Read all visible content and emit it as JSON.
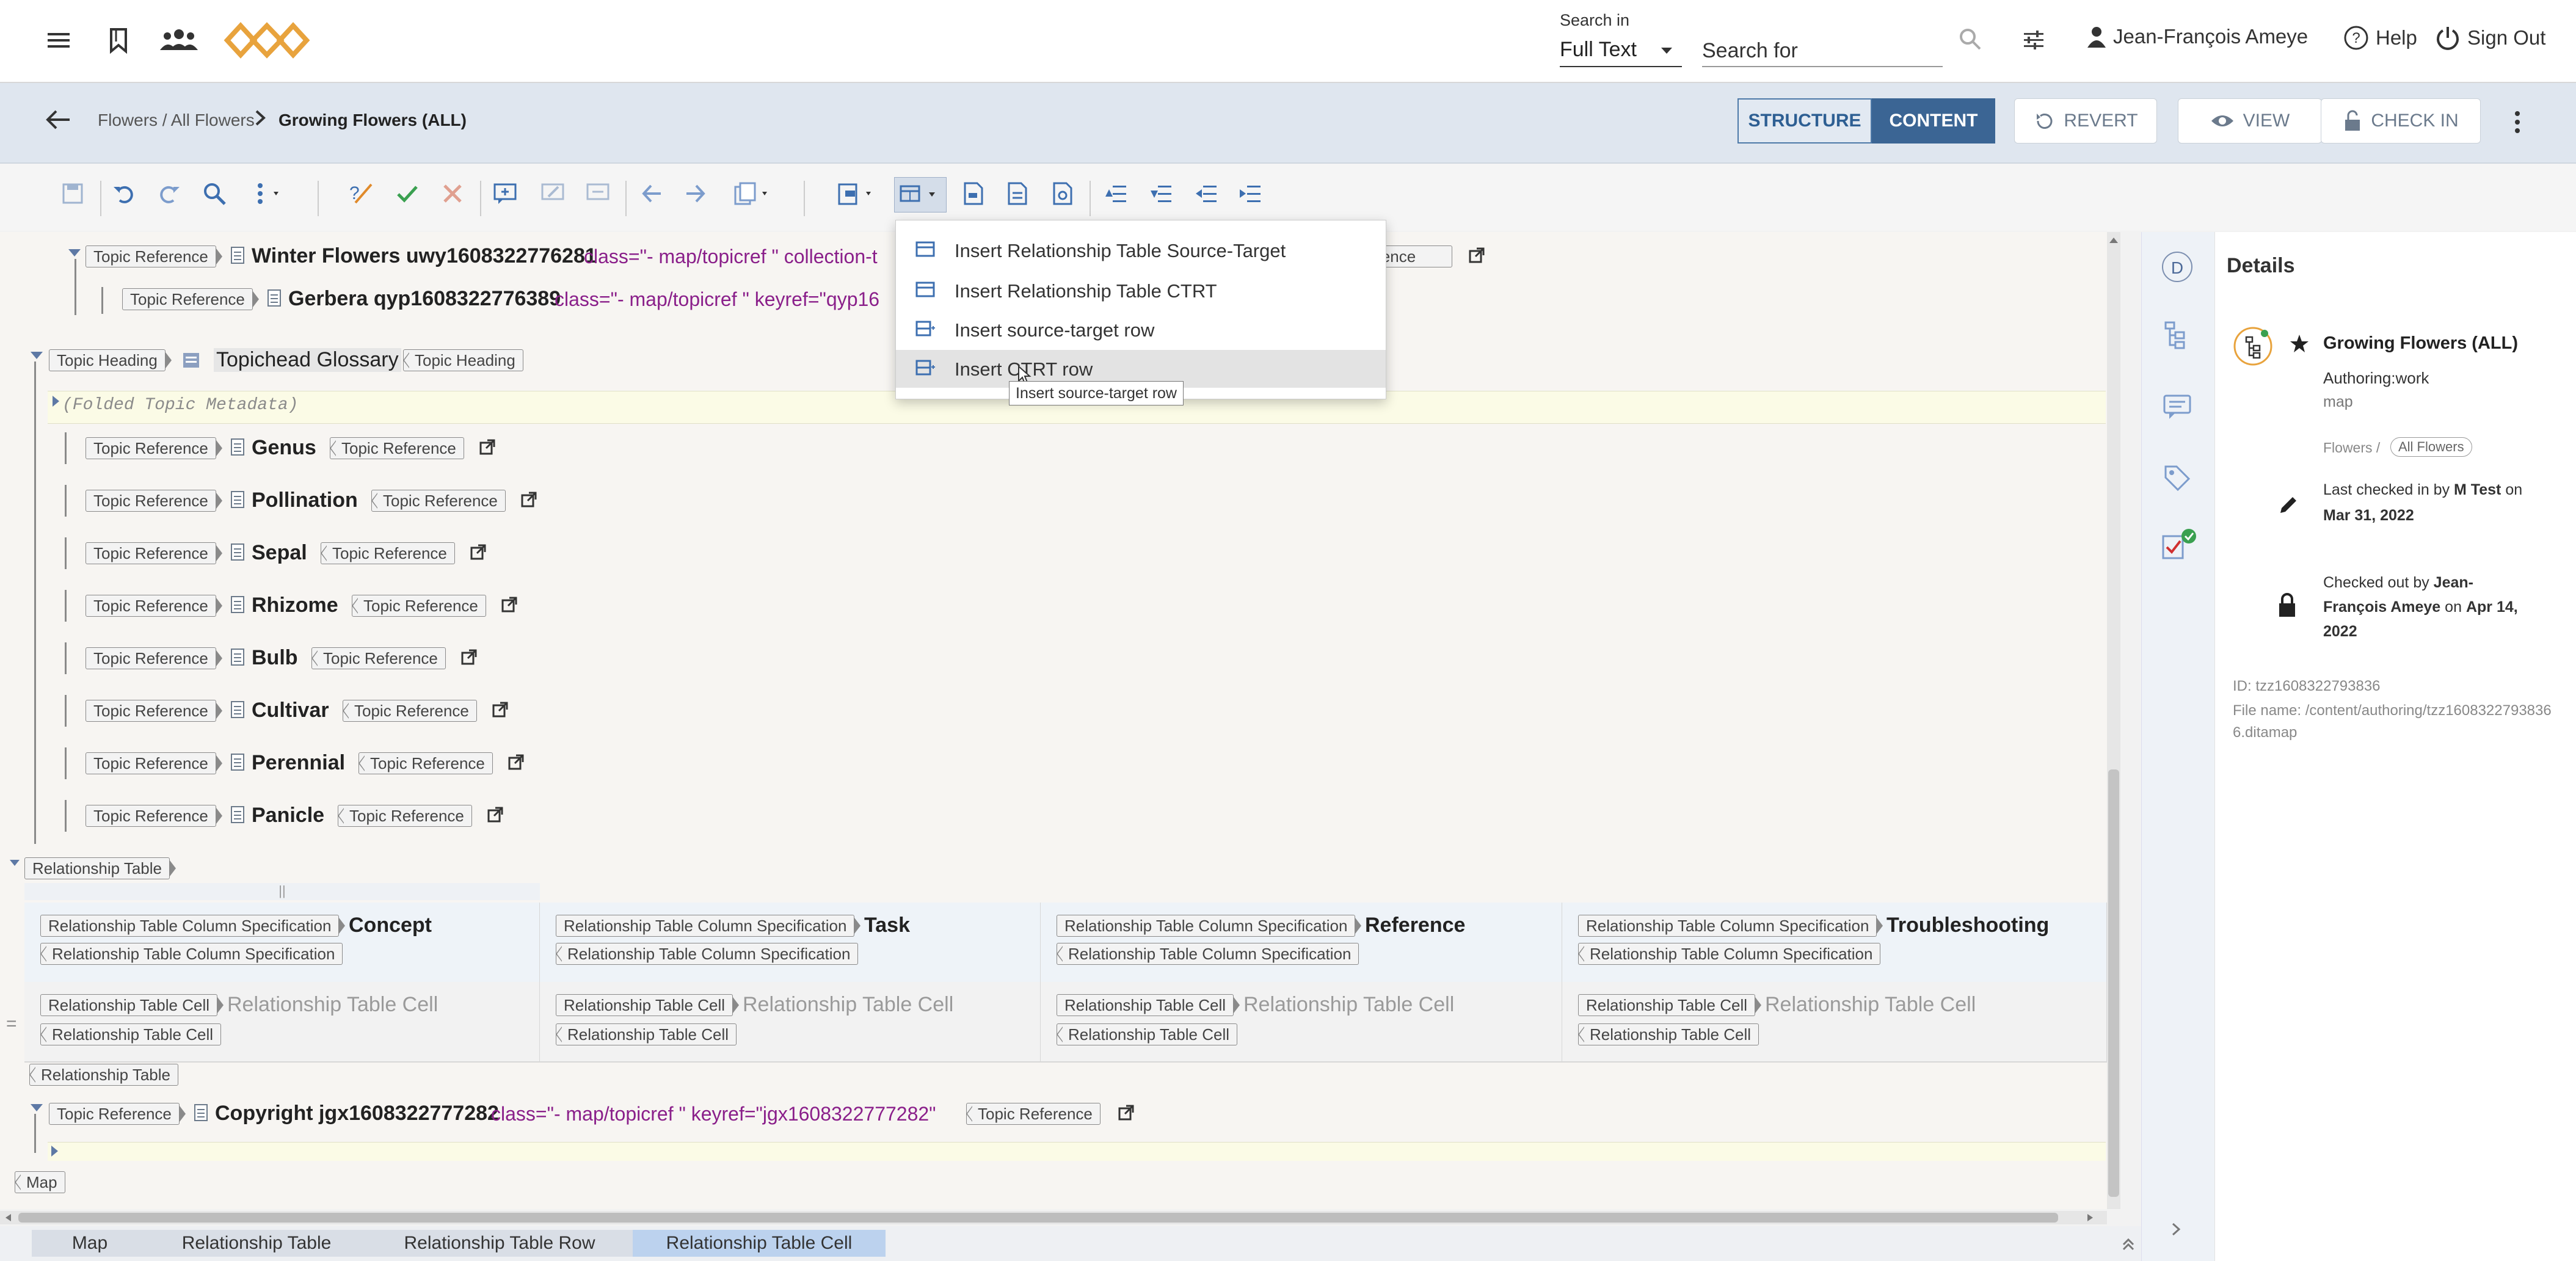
{
  "topbar": {
    "search_in_label": "Search in",
    "search_scope": "Full Text",
    "search_placeholder": "Search for",
    "user_name": "Jean-François Ameye",
    "help_label": "Help",
    "signout_label": "Sign Out"
  },
  "breadcrumb": {
    "parent": "Flowers / All Flowers",
    "current": "Growing Flowers (ALL)"
  },
  "view_toggle": {
    "structure": "STRUCTURE",
    "content": "CONTENT"
  },
  "actions": {
    "revert": "REVERT",
    "view": "VIEW",
    "check_in": "CHECK IN"
  },
  "menu": {
    "items": [
      "Insert Relationship Table Source-Target",
      "Insert Relationship Table CTRT",
      "Insert source-target row",
      "Insert CTRT row"
    ],
    "tooltip": "Insert source-target row"
  },
  "tags": {
    "topic_reference": "Topic Reference",
    "topic_heading": "Topic Heading",
    "folded_metadata": "(Folded Topic Metadata)",
    "relationship_table": "Relationship Table",
    "rel_col_spec": "Relationship Table Column Specification",
    "rel_cell": "Relationship Table Cell",
    "map": "Map",
    "eference_partial": "eference"
  },
  "editor": {
    "winter_title": "Winter Flowers uwy1608322776281",
    "winter_attr": "class=\"- map/topicref \" collection-t",
    "gerbera_title": "Gerbera qyp1608322776389",
    "gerbera_attr": "class=\"- map/topicref \"  keyref=\"qyp16",
    "topichead_title": "Topichead Glossary",
    "glossary": [
      "Genus",
      "Pollination",
      "Sepal",
      "Rhizome",
      "Bulb",
      "Cultivar",
      "Perennial",
      "Panicle"
    ],
    "columns": [
      "Concept",
      "Task",
      "Reference",
      "Troubleshooting"
    ],
    "copyright_title": "Copyright jgx1608322777282",
    "copyright_attr": "class=\"- map/topicref \"  keyref=\"jgx1608322777282\""
  },
  "path": [
    "Map",
    "Relationship Table",
    "Relationship Table Row",
    "Relationship Table Cell"
  ],
  "details": {
    "heading": "Details",
    "rail_letter": "D",
    "title": "Growing Flowers (ALL)",
    "status": "Authoring:work",
    "type": "map",
    "folder_prefix": "Flowers /",
    "folder_chip": "All Flowers",
    "checked_in_prefix": "Last checked in by",
    "checked_in_user": "M Test",
    "checked_in_on": "on",
    "checked_in_date": "Mar 31, 2022",
    "checked_out_prefix": "Checked out by",
    "checked_out_user1": "Jean-",
    "checked_out_user2": "François Ameye",
    "checked_out_on": "on",
    "checked_out_date1": "Apr 14,",
    "checked_out_date2": "2022",
    "id": "ID: tzz1608322793836",
    "file_name_1": "File name: /content/authoring/tzz1608322793836",
    "file_name_2": "6.ditamap"
  },
  "colors": {
    "accent": "#3b6594",
    "attr": "#8a1f8a",
    "logo": "#e8a33d"
  }
}
